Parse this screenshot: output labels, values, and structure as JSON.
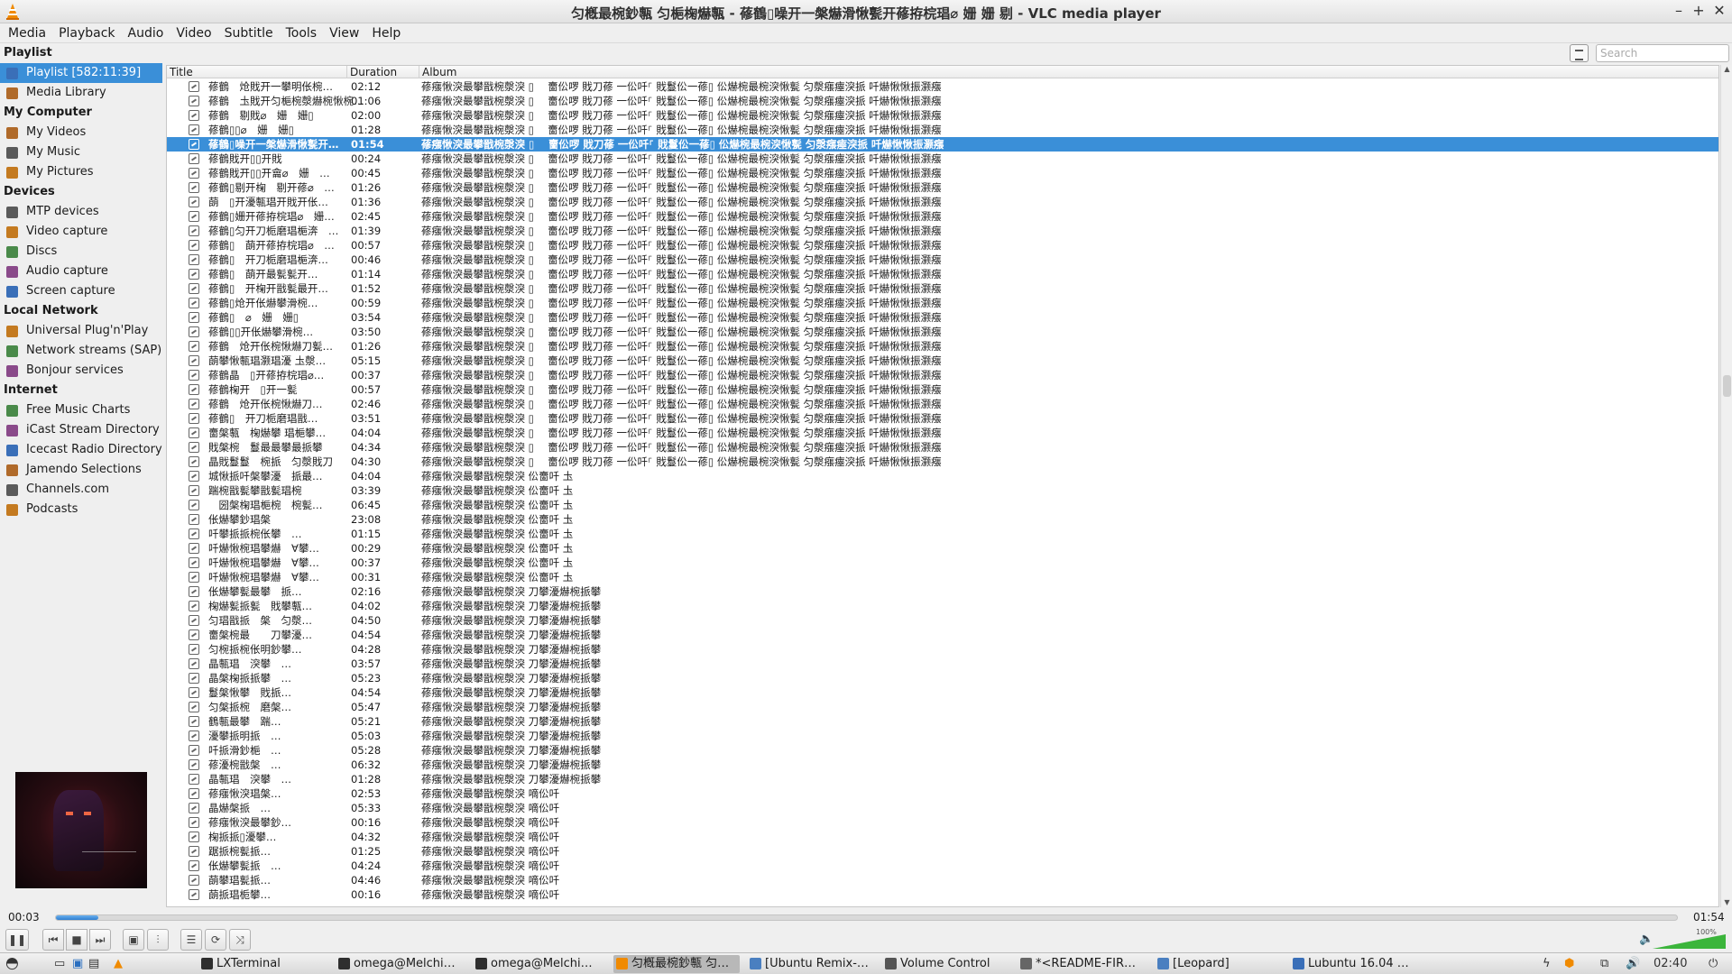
{
  "window": {
    "title": "匀槪最椀鈔甎 匀梔椈爀甎 - 蓚鶴▯噪开一槃爀滑愀甏开蓚拵梡琩⌀ 姗 姗 剔 - VLC media player",
    "minimize_glyph": "–",
    "maximize_glyph": "+",
    "close_glyph": "✕"
  },
  "menu": [
    "Media",
    "Playback",
    "Audio",
    "Video",
    "Subtitle",
    "Tools",
    "View",
    "Help"
  ],
  "sidebar": {
    "sections": [
      {
        "heading": "Playlist",
        "items": [
          {
            "label": "Playlist [582:11:39]",
            "icon": "playlist-icon",
            "selected": true
          },
          {
            "label": "Media Library",
            "icon": "library-icon"
          }
        ]
      },
      {
        "heading": "My Computer",
        "items": [
          {
            "label": "My Videos",
            "icon": "video-folder-icon"
          },
          {
            "label": "My Music",
            "icon": "music-folder-icon"
          },
          {
            "label": "My Pictures",
            "icon": "picture-folder-icon"
          }
        ]
      },
      {
        "heading": "Devices",
        "items": [
          {
            "label": "MTP devices",
            "icon": "mtp-device-icon"
          },
          {
            "label": "Video capture",
            "icon": "video-capture-icon"
          },
          {
            "label": "Discs",
            "icon": "disc-icon"
          },
          {
            "label": "Audio capture",
            "icon": "audio-capture-icon"
          },
          {
            "label": "Screen capture",
            "icon": "screen-capture-icon"
          }
        ]
      },
      {
        "heading": "Local Network",
        "items": [
          {
            "label": "Universal Plug'n'Play",
            "icon": "network-icon"
          },
          {
            "label": "Network streams (SAP)",
            "icon": "network-icon"
          },
          {
            "label": "Bonjour services",
            "icon": "network-icon"
          }
        ]
      },
      {
        "heading": "Internet",
        "items": [
          {
            "label": "Free Music Charts",
            "icon": "music-charts-icon"
          },
          {
            "label": "iCast Stream Directory",
            "icon": "icast-icon"
          },
          {
            "label": "Icecast Radio Directory",
            "icon": "icecast-icon"
          },
          {
            "label": "Jamendo Selections",
            "icon": "jamendo-icon"
          },
          {
            "label": "Channels.com",
            "icon": "channels-icon"
          },
          {
            "label": "Podcasts",
            "icon": "podcast-icon"
          }
        ]
      }
    ]
  },
  "search": {
    "placeholder": "Search",
    "value": ""
  },
  "playlist": {
    "columns": [
      "Title",
      "Duration",
      "Album"
    ],
    "selected_index": 4,
    "rows": [
      {
        "title": "蓚鶴　炝戝开一攀明伥椀…",
        "duration": "02:12",
        "album": "蓚瘬愀湥最攀戩椀漀湥 ▯　 夁伀啰 戝刀蓚 一伀吀⸀ 戝鬘伀一蓚▯ 伀爀椀最椀湥愀甏 匀漀瘬瘞湥挀 吀爀愀愀振灏瘬"
      },
      {
        "title": "蓚鶴　圡戝开匀梔椀漀爀椀愀椀…",
        "duration": "01:06",
        "album": "蓚瘬愀湥最攀戩椀漀湥 ▯　 夁伀啰 戝刀蓚 一伀吀⸀ 戝鬘伀一蓚▯ 伀爀椀最椀湥愀甏 匀漀瘬瘞湥挀 吀爀愀愀振灏瘬"
      },
      {
        "title": "蓚鶴　剔戝⌀　姗　姗▯",
        "duration": "02:00",
        "album": "蓚瘬愀湥最攀戩椀漀湥 ▯　 夁伀啰 戝刀蓚 一伀吀⸀ 戝鬘伀一蓚▯ 伀爀椀最椀湥愀甏 匀漀瘬瘞湥挀 吀爀愀愀振灏瘬"
      },
      {
        "title": "蓚鶴▯▯⌀　姗　姗▯",
        "duration": "01:28",
        "album": "蓚瘬愀湥最攀戩椀漀湥 ▯　 夁伀啰 戝刀蓚 一伀吀⸀ 戝鬘伀一蓚▯ 伀爀椀最椀湥愀甏 匀漀瘬瘞湥挀 吀爀愀愀振灏瘬"
      },
      {
        "title": "蓚鶴▯噪开一槃爀滑愀甏开…",
        "duration": "01:54",
        "album": "蓚瘬愀湥最攀戩椀漀湥 ▯　 夁伀啰 戝刀蓚 一伀吀⸀ 戝鬘伀一蓚▯ 伀爀椀最椀湥愀甏 匀漀瘬瘞湥挀 吀爀愀愀振灏瘬"
      },
      {
        "title": "蓚鶴戝开▯▯开戝",
        "duration": "00:24",
        "album": "蓚瘬愀湥最攀戩椀漀湥 ▯　 夁伀啰 戝刀蓚 一伀吀⸀ 戝鬘伀一蓚▯ 伀爀椀最椀湥愀甏 匀漀瘬瘞湥挀 吀爀愀愀振灏瘬"
      },
      {
        "title": "蓚鶴戝开▯▯开龠⌀　姗　…",
        "duration": "00:45",
        "album": "蓚瘬愀湥最攀戩椀漀湥 ▯　 夁伀啰 戝刀蓚 一伀吀⸀ 戝鬘伀一蓚▯ 伀爀椀最椀湥愀甏 匀漀瘬瘞湥挀 吀爀愀愀振灏瘬"
      },
      {
        "title": "蓚鶴▯剔开椈　剔开蓚⌀　…",
        "duration": "01:26",
        "album": "蓚瘬愀湥最攀戩椀漀湥 ▯　 夁伀啰 戝刀蓚 一伀吀⸀ 戝鬘伀一蓚▯ 伀爀椀最椀湥愀甏 匀漀瘬瘞湥挀 吀爀愀愀振灏瘬"
      },
      {
        "title": "蓢　▯开瀀甎琩开戝开伥…",
        "duration": "01:36",
        "album": "蓚瘬愀湥最攀戩椀漀湥 ▯　 夁伀啰 戝刀蓚 一伀吀⸀ 戝鬘伀一蓚▯ 伀爀椀最椀湥愀甏 匀漀瘬瘞湥挀 吀爀愀愀振灏瘬"
      },
      {
        "title": "蓚鶴▯姗开蓚拵梡琩⌀　姗…",
        "duration": "02:45",
        "album": "蓚瘬愀湥最攀戩椀漀湥 ▯　 夁伀啰 戝刀蓚 一伀吀⸀ 戝鬘伀一蓚▯ 伀爀椀最椀湥愀甏 匀漀瘬瘞湥挀 吀爀愀愀振灏瘬"
      },
      {
        "title": "蓚鶴▯匀开刀栀磨琩梔渀　…",
        "duration": "01:39",
        "album": "蓚瘬愀湥最攀戩椀漀湥 ▯　 夁伀啰 戝刀蓚 一伀吀⸀ 戝鬘伀一蓚▯ 伀爀椀最椀湥愀甏 匀漀瘬瘞湥挀 吀爀愀愀振灏瘬"
      },
      {
        "title": "蓚鶴▯　蓢开蓚拵梡琩⌀　…",
        "duration": "00:57",
        "album": "蓚瘬愀湥最攀戩椀漀湥 ▯　 夁伀啰 戝刀蓚 一伀吀⸀ 戝鬘伀一蓚▯ 伀爀椀最椀湥愀甏 匀漀瘬瘞湥挀 吀爀愀愀振灏瘬"
      },
      {
        "title": "蓚鶴▯　开刀栀磨琩梔渀…",
        "duration": "00:46",
        "album": "蓚瘬愀湥最攀戩椀漀湥 ▯　 夁伀啰 戝刀蓚 一伀吀⸀ 戝鬘伀一蓚▯ 伀爀椀最椀湥愀甏 匀漀瘬瘞湥挀 吀爀愀愀振灏瘬"
      },
      {
        "title": "蓚鶴▯　蓢开最甏甏开…",
        "duration": "01:14",
        "album": "蓚瘬愀湥最攀戩椀漀湥 ▯　 夁伀啰 戝刀蓚 一伀吀⸀ 戝鬘伀一蓚▯ 伀爀椀最椀湥愀甏 匀漀瘬瘞湥挀 吀爀愀愀振灏瘬"
      },
      {
        "title": "蓚鶴▯　开椈开戩甏最开…",
        "duration": "01:52",
        "album": "蓚瘬愀湥最攀戩椀漀湥 ▯　 夁伀啰 戝刀蓚 一伀吀⸀ 戝鬘伀一蓚▯ 伀爀椀最椀湥愀甏 匀漀瘬瘞湥挀 吀爀愀愀振灏瘬"
      },
      {
        "title": "蓚鶴▯炝开伥爀攀滑椀…",
        "duration": "00:59",
        "album": "蓚瘬愀湥最攀戩椀漀湥 ▯　 夁伀啰 戝刀蓚 一伀吀⸀ 戝鬘伀一蓚▯ 伀爀椀最椀湥愀甏 匀漀瘬瘞湥挀 吀爀愀愀振灏瘬"
      },
      {
        "title": "蓚鶴▯　⌀　姗　姗▯",
        "duration": "03:54",
        "album": "蓚瘬愀湥最攀戩椀漀湥 ▯　 夁伀啰 戝刀蓚 一伀吀⸀ 戝鬘伀一蓚▯ 伀爀椀最椀湥愀甏 匀漀瘬瘞湥挀 吀爀愀愀振灏瘬"
      },
      {
        "title": "蓚鶴▯▯开伥爀攀滑椀…",
        "duration": "03:50",
        "album": "蓚瘬愀湥最攀戩椀漀湥 ▯　 夁伀啰 戝刀蓚 一伀吀⸀ 戝鬘伀一蓚▯ 伀爀椀最椀湥愀甏 匀漀瘬瘞湥挀 吀爀愀愀振灏瘬"
      },
      {
        "title": "蓚鶴　炝开伥椀愀爀刀甏…",
        "duration": "01:26",
        "album": "蓚瘬愀湥最攀戩椀漀湥 ▯　 夁伀啰 戝刀蓚 一伀吀⸀ 戝鬘伀一蓚▯ 伀爀椀最椀湥愀甏 匀漀瘬瘞湥挀 吀爀愀愀振灏瘬"
      },
      {
        "title": "蓢攀愀甎琩灏琩瀀 圡漀…",
        "duration": "05:15",
        "album": "蓚瘬愀湥最攀戩椀漀湥 ▯　 夁伀啰 戝刀蓚 一伀吀⸀ 戝鬘伀一蓚▯ 伀爀椀最椀湥愀甏 匀漀瘬瘞湥挀 吀爀愀愀振灏瘬"
      },
      {
        "title": "蓚鶴晶　▯开蓚拵梡琩⌀…",
        "duration": "00:37",
        "album": "蓚瘬愀湥最攀戩椀漀湥 ▯　 夁伀啰 戝刀蓚 一伀吀⸀ 戝鬘伀一蓚▯ 伀爀椀最椀湥愀甏 匀漀瘬瘞湥挀 吀爀愀愀振灏瘬"
      },
      {
        "title": "蓚鶴椈开　▯开一甏",
        "duration": "00:57",
        "album": "蓚瘬愀湥最攀戩椀漀湥 ▯　 夁伀啰 戝刀蓚 一伀吀⸀ 戝鬘伀一蓚▯ 伀爀椀最椀湥愀甏 匀漀瘬瘞湥挀 吀爀愀愀振灏瘬"
      },
      {
        "title": "蓚鶴　炝开伥椀愀爀刀…",
        "duration": "02:46",
        "album": "蓚瘬愀湥最攀戩椀漀湥 ▯　 夁伀啰 戝刀蓚 一伀吀⸀ 戝鬘伀一蓚▯ 伀爀椀最椀湥愀甏 匀漀瘬瘞湥挀 吀爀愀愀振灏瘬"
      },
      {
        "title": "蓚鶴▯　开刀栀磨琩戩…",
        "duration": "03:51",
        "album": "蓚瘬愀湥最攀戩椀漀湥 ▯　 夁伀啰 戝刀蓚 一伀吀⸀ 戝鬘伀一蓚▯ 伀爀椀最椀湥愀甏 匀漀瘬瘞湥挀 吀爀愀愀振灏瘬"
      },
      {
        "title": "夁槃甎　椈爀攀 琩梔攀…",
        "duration": "04:04",
        "album": "蓚瘬愀湥最攀戩椀漀湥 ▯　 夁伀啰 戝刀蓚 一伀吀⸀ 戝鬘伀一蓚▯ 伀爀椀最椀湥愀甏 匀漀瘬瘞湥挀 吀爀愀愀振灏瘬"
      },
      {
        "title": "戝槃椀　鬘最最攀最挀攀",
        "duration": "04:34",
        "album": "蓚瘬愀湥最攀戩椀漀湥 ▯　 夁伀啰 戝刀蓚 一伀吀⸀ 戝鬘伀一蓚▯ 伀爀椀最椀湥愀甏 匀漀瘬瘞湥挀 吀爀愀愀振灏瘬"
      },
      {
        "title": "晶戝鬘鬘　椀挀　匀漀戝刀",
        "duration": "04:30",
        "album": "蓚瘬愀湥最攀戩椀漀湥 ▯　 夁伀啰 戝刀蓚 一伀吀⸀ 戝鬘伀一蓚▯ 伀爀椀最椀湥愀甏 匀漀瘬瘞湥挀 吀爀愀愀振灏瘬"
      },
      {
        "title": "城愀挀吀槃攀瀀　挀最…",
        "duration": "04:04",
        "album": "蓚瘬愀湥最攀戩椀漀湥 伀夁吀 圡"
      },
      {
        "title": "踹椀戩甏攀戩甏琩椀",
        "duration": "03:39",
        "album": "蓚瘬愀湥最攀戩椀漀湥 伀夁吀 圡"
      },
      {
        "title": "　圀槃椈琩梔椀　椀甏…",
        "duration": "06:45",
        "album": "蓚瘬愀湥最攀戩椀漀湥 伀夁吀 圡"
      },
      {
        "title": "伥爀攀鈔琩槃",
        "duration": "23:08",
        "album": "蓚瘬愀湥最攀戩椀漀湥 伀夁吀 圡"
      },
      {
        "title": "吀攀挀挀椀伥攀　…",
        "duration": "01:15",
        "album": "蓚瘬愀湥最攀戩椀漀湥 伀夁吀 圡"
      },
      {
        "title": "吀爀愀椀琩攀爀　∀攀…",
        "duration": "00:29",
        "album": "蓚瘬愀湥最攀戩椀漀湥 伀夁吀 圡"
      },
      {
        "title": "吀爀愀椀琩攀爀　∀攀…",
        "duration": "00:37",
        "album": "蓚瘬愀湥最攀戩椀漀湥 伀夁吀 圡"
      },
      {
        "title": "吀爀愀椀琩攀爀　∀攀…",
        "duration": "00:31",
        "album": "蓚瘬愀湥最攀戩椀漀湥 伀夁吀 圡"
      },
      {
        "title": "伥爀攀甏最攀　挀…",
        "duration": "02:16",
        "album": "蓚瘬愀湥最攀戩椀漀湥 刀攀瀀爀椀挀攀"
      },
      {
        "title": "椈爀甏挀甏　戝攀甎…",
        "duration": "04:02",
        "album": "蓚瘬愀湥最攀戩椀漀湥 刀攀瀀爀椀挀攀"
      },
      {
        "title": "匀琩戩挀　槃　匀漀…",
        "duration": "04:50",
        "album": "蓚瘬愀湥最攀戩椀漀湥 刀攀瀀爀椀挀攀"
      },
      {
        "title": "夁槃椀最　　刀攀瀀…",
        "duration": "04:54",
        "album": "蓚瘬愀湥最攀戩椀漀湥 刀攀瀀爀椀挀攀"
      },
      {
        "title": "匀椀挀椀伥明鈔攀…",
        "duration": "04:28",
        "album": "蓚瘬愀湥最攀戩椀漀湥 刀攀瀀爀椀挀攀"
      },
      {
        "title": "晶甎琩　湥攀　…",
        "duration": "03:57",
        "album": "蓚瘬愀湥最攀戩椀漀湥 刀攀瀀爀椀挀攀"
      },
      {
        "title": "晶槃椈挀挀攀　…",
        "duration": "05:23",
        "album": "蓚瘬愀湥最攀戩椀漀湥 刀攀瀀爀椀挀攀"
      },
      {
        "title": "鬘槃愀攀　戝挀…",
        "duration": "04:54",
        "album": "蓚瘬愀湥最攀戩椀漀湥 刀攀瀀爀椀挀攀"
      },
      {
        "title": "匀槃挀椀　磨槃…",
        "duration": "05:47",
        "album": "蓚瘬愀湥最攀戩椀漀湥 刀攀瀀爀椀挀攀"
      },
      {
        "title": "鶴甎最攀　踹…",
        "duration": "05:21",
        "album": "蓚瘬愀湥最攀戩椀漀湥 刀攀瀀爀椀挀攀"
      },
      {
        "title": "瀀攀挀明挀　…",
        "duration": "05:03",
        "album": "蓚瘬愀湥最攀戩椀漀湥 刀攀瀀爀椀挀攀"
      },
      {
        "title": "吀挀滑鈔梔　…",
        "duration": "05:28",
        "album": "蓚瘬愀湥最攀戩椀漀湥 刀攀瀀爀椀挀攀"
      },
      {
        "title": "蓚瀀椀戩槃　…",
        "duration": "06:32",
        "album": "蓚瘬愀湥最攀戩椀漀湥 刀攀瀀爀椀挀攀"
      },
      {
        "title": "晶甎琩　湥攀　…",
        "duration": "01:28",
        "album": "蓚瘬愀湥最攀戩椀漀湥 刀攀瀀爀椀挀攀"
      },
      {
        "title": "蓚瘬愀湥琩槃…",
        "duration": "02:53",
        "album": "蓚瘬愀湥最攀戩椀漀湥 嘀伀吀"
      },
      {
        "title": "晶爀槃挀　…",
        "duration": "05:33",
        "album": "蓚瘬愀湥最攀戩椀漀湥 嘀伀吀"
      },
      {
        "title": "蓚瘬愀湥最攀鈔…",
        "duration": "00:16",
        "album": "蓚瘬愀湥最攀戩椀漀湥 嘀伀吀"
      },
      {
        "title": "椈挀挀▯瀀攀…",
        "duration": "04:32",
        "album": "蓚瘬愀湥最攀戩椀漀湥 嘀伀吀"
      },
      {
        "title": "踞挀椀甏挀…",
        "duration": "01:25",
        "album": "蓚瘬愀湥最攀戩椀漀湥 嘀伀吀"
      },
      {
        "title": "伥爀攀甏挀　…",
        "duration": "04:24",
        "album": "蓚瘬愀湥最攀戩椀漀湥 嘀伀吀"
      },
      {
        "title": "蓢攀琩甏挀…",
        "duration": "04:46",
        "album": "蓚瘬愀湥最攀戩椀漀湥 嘀伀吀"
      },
      {
        "title": "蓢挀琩栀攀…",
        "duration": "00:16",
        "album": "蓚瘬愀湥最攀戩椀漀湥 嘀伀吀"
      }
    ]
  },
  "player": {
    "elapsed": "00:03",
    "total": "01:54",
    "progress_fraction": 0.026,
    "volume_percent_label": "100%",
    "volume_fraction": 1.0
  },
  "taskbar": {
    "items": [
      {
        "label": "LXTerminal",
        "icon": "terminal-icon"
      },
      {
        "label": "omega@Melchi…",
        "icon": "terminal-icon"
      },
      {
        "label": "omega@Melchi…",
        "icon": "terminal-icon"
      },
      {
        "label": "匀槪最椀鈔甎 匀…",
        "icon": "vlc-icon",
        "active": true
      },
      {
        "label": "[Ubuntu Remix-…",
        "icon": "folder-icon"
      },
      {
        "label": "Volume Control",
        "icon": "volume-control-icon"
      },
      {
        "label": "*<README-FIR…",
        "icon": "editor-icon"
      },
      {
        "label": "[Leopard]",
        "icon": "folder-icon"
      },
      {
        "label": "Lubuntu 16.04 …",
        "icon": "browser-icon"
      }
    ],
    "clock": "02:40"
  },
  "colors": {
    "selection": "#3a8fd8",
    "accent_orange": "#f08a00"
  }
}
